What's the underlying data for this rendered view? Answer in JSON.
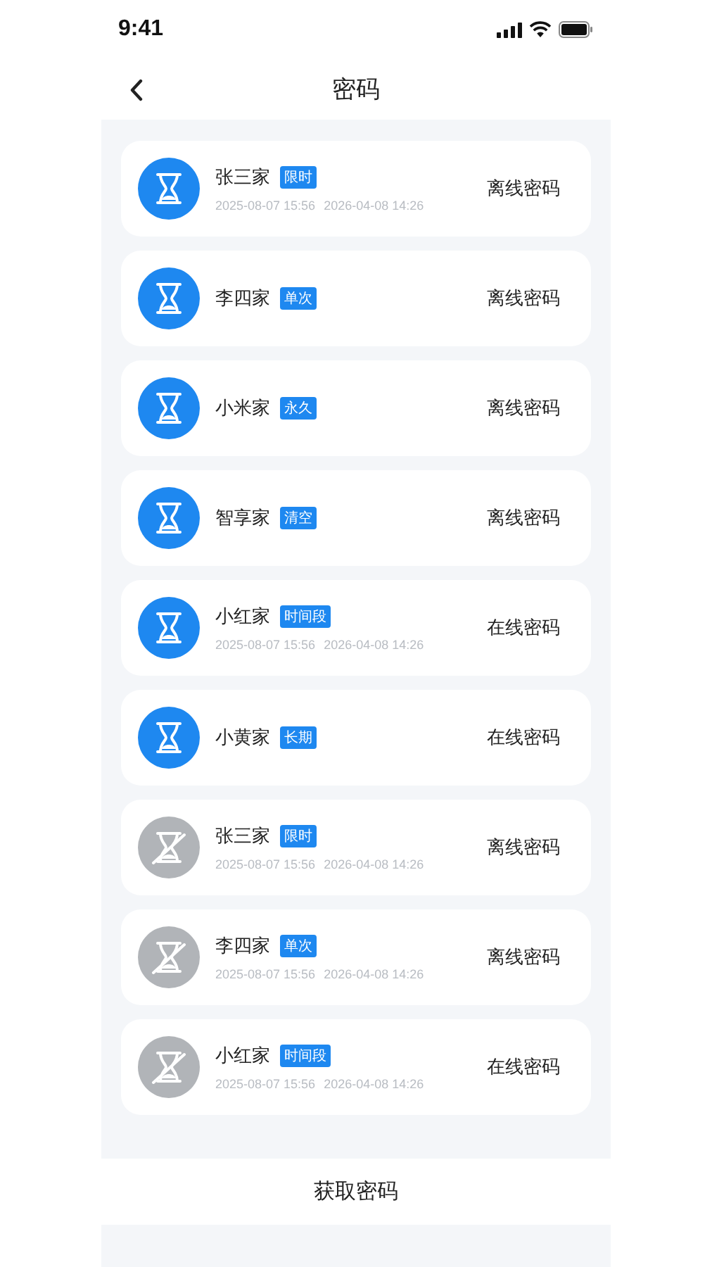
{
  "status_bar": {
    "time": "9:41"
  },
  "nav": {
    "title": "密码"
  },
  "passwords": [
    {
      "name": "张三家",
      "tag": "限时",
      "start": "2025-08-07 15:56",
      "end": "2026-04-08 14:26",
      "type": "离线密码",
      "expired": false
    },
    {
      "name": "李四家",
      "tag": "单次",
      "type": "离线密码",
      "expired": false
    },
    {
      "name": "小米家",
      "tag": "永久",
      "type": "离线密码",
      "expired": false
    },
    {
      "name": "智享家",
      "tag": "清空",
      "type": "离线密码",
      "expired": false
    },
    {
      "name": "小红家",
      "tag": "时间段",
      "start": "2025-08-07 15:56",
      "end": "2026-04-08 14:26",
      "type": "在线密码",
      "expired": false
    },
    {
      "name": "小黄家",
      "tag": "长期",
      "type": "在线密码",
      "expired": false
    },
    {
      "name": "张三家",
      "tag": "限时",
      "start": "2025-08-07 15:56",
      "end": "2026-04-08 14:26",
      "type": "离线密码",
      "expired": true
    },
    {
      "name": "李四家",
      "tag": "单次",
      "start": "2025-08-07 15:56",
      "end": "2026-04-08 14:26",
      "type": "离线密码",
      "expired": true
    },
    {
      "name": "小红家",
      "tag": "时间段",
      "start": "2025-08-07 15:56",
      "end": "2026-04-08 14:26",
      "type": "在线密码",
      "expired": true
    }
  ],
  "bottom_button": "获取密码"
}
